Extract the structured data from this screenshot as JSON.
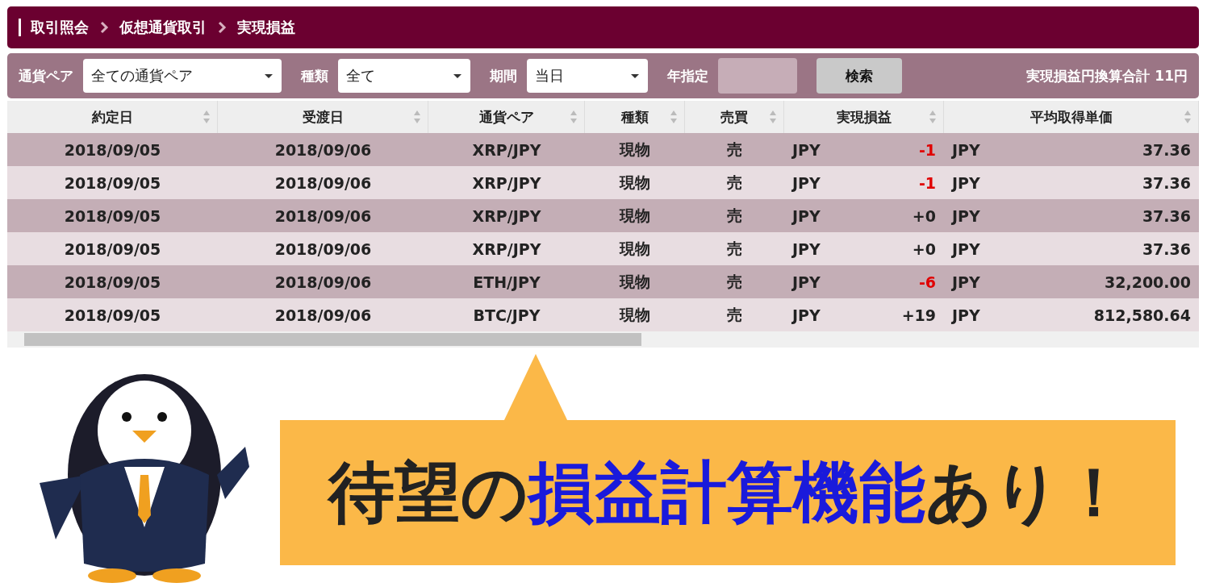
{
  "breadcrumb": [
    "取引照会",
    "仮想通貨取引",
    "実現損益"
  ],
  "filters": [
    {
      "kind": "select",
      "label": "通貨ペア",
      "value": "全ての通貨ペア"
    },
    {
      "kind": "select",
      "label": "種類",
      "value": "全て"
    },
    {
      "kind": "select",
      "label": "期間",
      "value": "当日"
    },
    {
      "kind": "input",
      "label": "年指定",
      "disabled": true
    }
  ],
  "search_button": "検索",
  "total": {
    "label": "実現損益円換算合計",
    "value": "11円"
  },
  "table": {
    "columns": [
      "約定日",
      "受渡日",
      "通貨ペア",
      "種類",
      "売買",
      "実現損益",
      "平均取得単価"
    ],
    "rows": [
      {
        "trade_date": "2018/09/05",
        "settle_date": "2018/09/06",
        "pair": "XRP/JPY",
        "type": "現物",
        "side": "売",
        "pl_currency": "JPY",
        "pl": "-1",
        "loss": true,
        "avg_currency": "JPY",
        "avg_price": "37.36"
      },
      {
        "trade_date": "2018/09/05",
        "settle_date": "2018/09/06",
        "pair": "XRP/JPY",
        "type": "現物",
        "side": "売",
        "pl_currency": "JPY",
        "pl": "-1",
        "loss": true,
        "avg_currency": "JPY",
        "avg_price": "37.36"
      },
      {
        "trade_date": "2018/09/05",
        "settle_date": "2018/09/06",
        "pair": "XRP/JPY",
        "type": "現物",
        "side": "売",
        "pl_currency": "JPY",
        "pl": "+0",
        "loss": false,
        "avg_currency": "JPY",
        "avg_price": "37.36"
      },
      {
        "trade_date": "2018/09/05",
        "settle_date": "2018/09/06",
        "pair": "XRP/JPY",
        "type": "現物",
        "side": "売",
        "pl_currency": "JPY",
        "pl": "+0",
        "loss": false,
        "avg_currency": "JPY",
        "avg_price": "37.36"
      },
      {
        "trade_date": "2018/09/05",
        "settle_date": "2018/09/06",
        "pair": "ETH/JPY",
        "type": "現物",
        "side": "売",
        "pl_currency": "JPY",
        "pl": "-6",
        "loss": true,
        "avg_currency": "JPY",
        "avg_price": "32,200.00"
      },
      {
        "trade_date": "2018/09/05",
        "settle_date": "2018/09/06",
        "pair": "BTC/JPY",
        "type": "現物",
        "side": "売",
        "pl_currency": "JPY",
        "pl": "+19",
        "loss": false,
        "avg_currency": "JPY",
        "avg_price": "812,580.64"
      }
    ]
  },
  "callout": [
    {
      "text": "待望の",
      "emphasis": false
    },
    {
      "text": "損益計算機能",
      "emphasis": true
    },
    {
      "text": "あり！",
      "emphasis": false
    }
  ]
}
